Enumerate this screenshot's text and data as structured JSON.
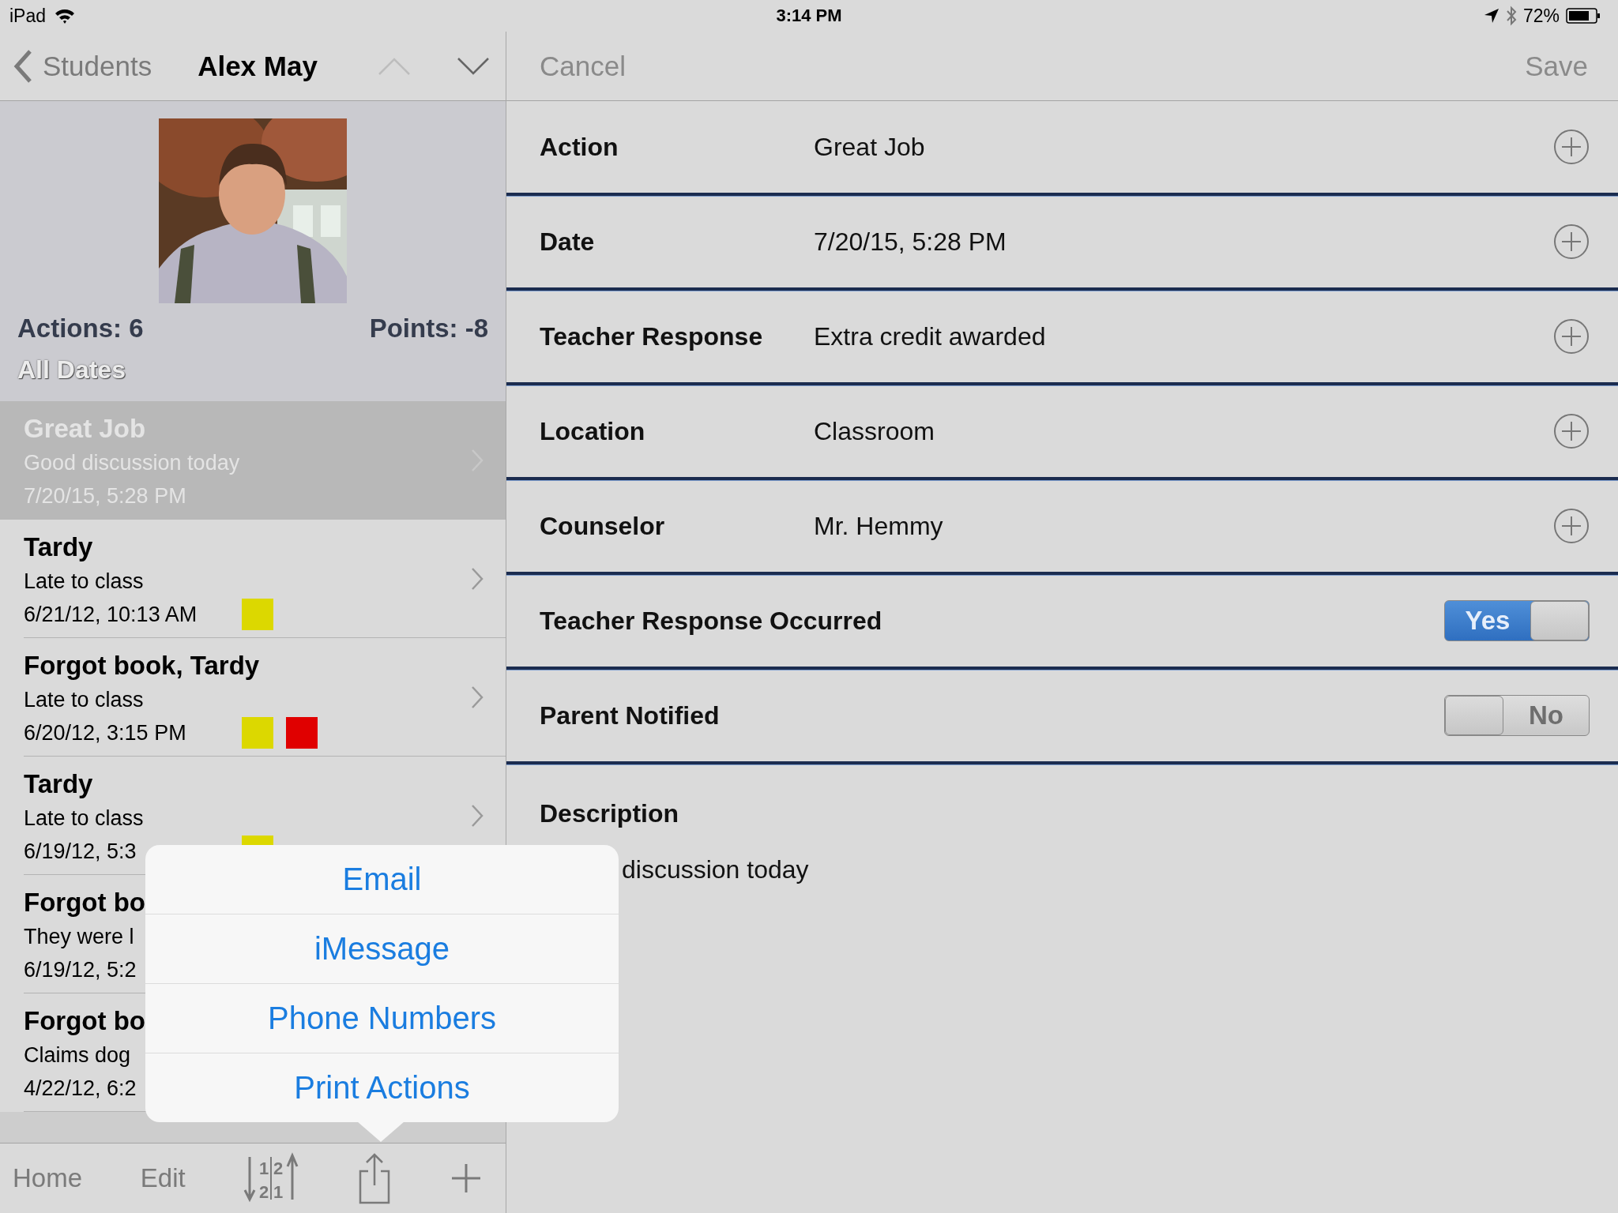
{
  "status_bar": {
    "device": "iPad",
    "time": "3:14 PM",
    "battery": "72%"
  },
  "nav": {
    "back": "Students",
    "title": "Alex May",
    "previous_disabled": true,
    "next_disabled": false
  },
  "student": {
    "actions": "Actions: 6",
    "points": "Points: -8",
    "filter": "All Dates"
  },
  "actions": [
    {
      "title": "Great Job",
      "note": "Good discussion today",
      "date": "7/20/15, 5:28 PM",
      "selected": true
    },
    {
      "title": "Tardy",
      "note": "Late to class",
      "date": "6/21/12, 10:13 AM",
      "selected": false,
      "tags": [
        {
          "color": "#dcd800"
        }
      ]
    },
    {
      "title": "Forgot book, Tardy",
      "note": "Late to class",
      "date": "6/20/12, 3:15 PM",
      "selected": false,
      "tags": [
        {
          "color": "#dcd800"
        },
        {
          "color": "#e00000"
        }
      ]
    },
    {
      "title": "Tardy",
      "note": "Late to class",
      "date": "6/19/12, 5:3",
      "selected": false,
      "tags": [
        {
          "color": "#dcd800"
        }
      ]
    },
    {
      "title": "Forgot bo",
      "note": "They were l",
      "date": "6/19/12, 5:2",
      "selected": false
    },
    {
      "title": "Forgot bo",
      "note": "Claims dog",
      "date": "4/22/12, 6:2",
      "selected": false
    }
  ],
  "toolbar": {
    "home": "Home",
    "edit": "Edit",
    "sort_digits": [
      "1",
      "2",
      "2",
      "1"
    ]
  },
  "share_menu": [
    "Email",
    "iMessage",
    "Phone Numbers",
    "Print Actions"
  ],
  "form": {
    "cancel": "Cancel",
    "save": "Save",
    "fields": [
      {
        "kind": "text",
        "label": "Action",
        "value": "Great Job"
      },
      {
        "kind": "text",
        "label": "Date",
        "value": "7/20/15, 5:28 PM"
      },
      {
        "kind": "text",
        "label": "Teacher Response",
        "value": "Extra credit awarded"
      },
      {
        "kind": "text",
        "label": "Location",
        "value": "Classroom"
      },
      {
        "kind": "text",
        "label": "Counselor",
        "value": "Mr. Hemmy"
      },
      {
        "kind": "switch",
        "label": "Teacher Response Occurred",
        "on": true,
        "text": "Yes"
      },
      {
        "kind": "switch",
        "label": "Parent Notified",
        "on": false,
        "text": "No"
      }
    ],
    "description": {
      "label": "Description",
      "value": "discussion today"
    }
  }
}
